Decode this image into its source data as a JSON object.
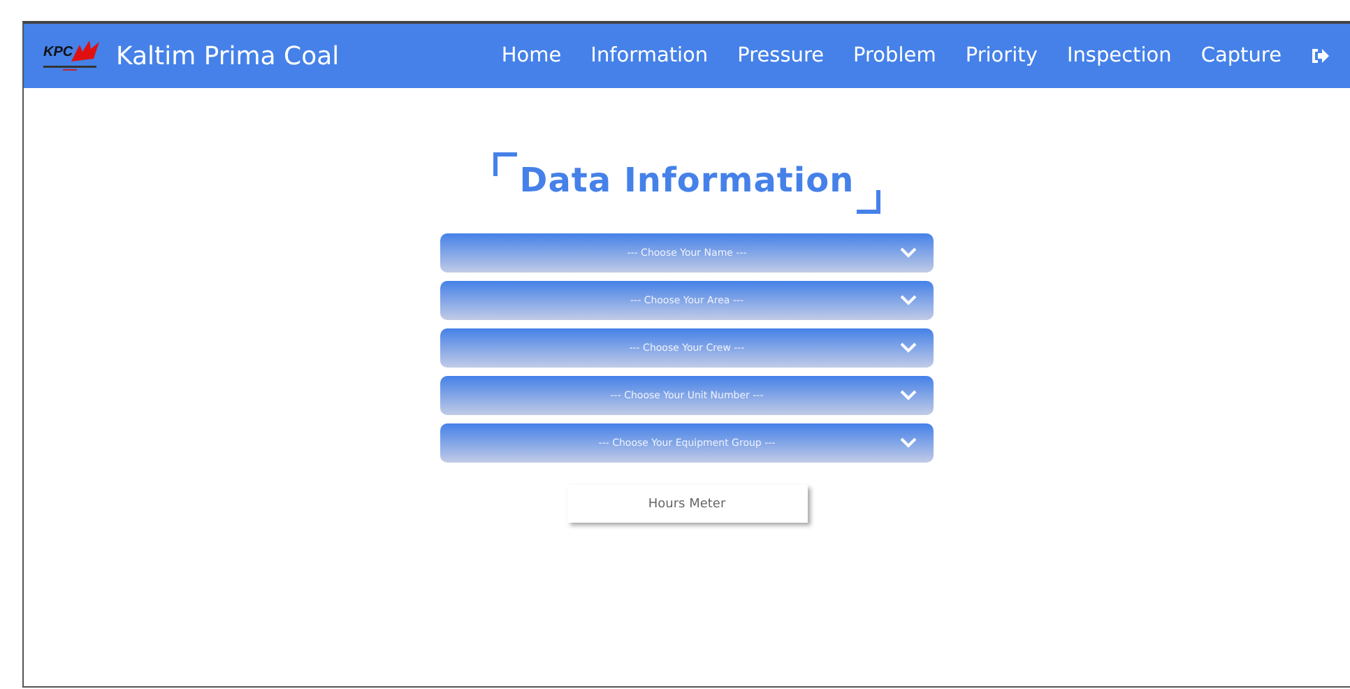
{
  "navbar": {
    "logo_text": "KPC",
    "brand": "Kaltim Prima Coal",
    "links": [
      {
        "label": "Home"
      },
      {
        "label": "Information"
      },
      {
        "label": "Pressure"
      },
      {
        "label": "Problem"
      },
      {
        "label": "Priority"
      },
      {
        "label": "Inspection"
      },
      {
        "label": "Capture"
      }
    ]
  },
  "title": "Data Information",
  "selects": [
    {
      "placeholder": "--- Choose Your Name ---"
    },
    {
      "placeholder": "--- Choose Your Area ---"
    },
    {
      "placeholder": "--- Choose Your Crew ---"
    },
    {
      "placeholder": "--- Choose Your Unit Number ---"
    },
    {
      "placeholder": "--- Choose Your Equipment Group ---"
    }
  ],
  "button": "Hours Meter"
}
